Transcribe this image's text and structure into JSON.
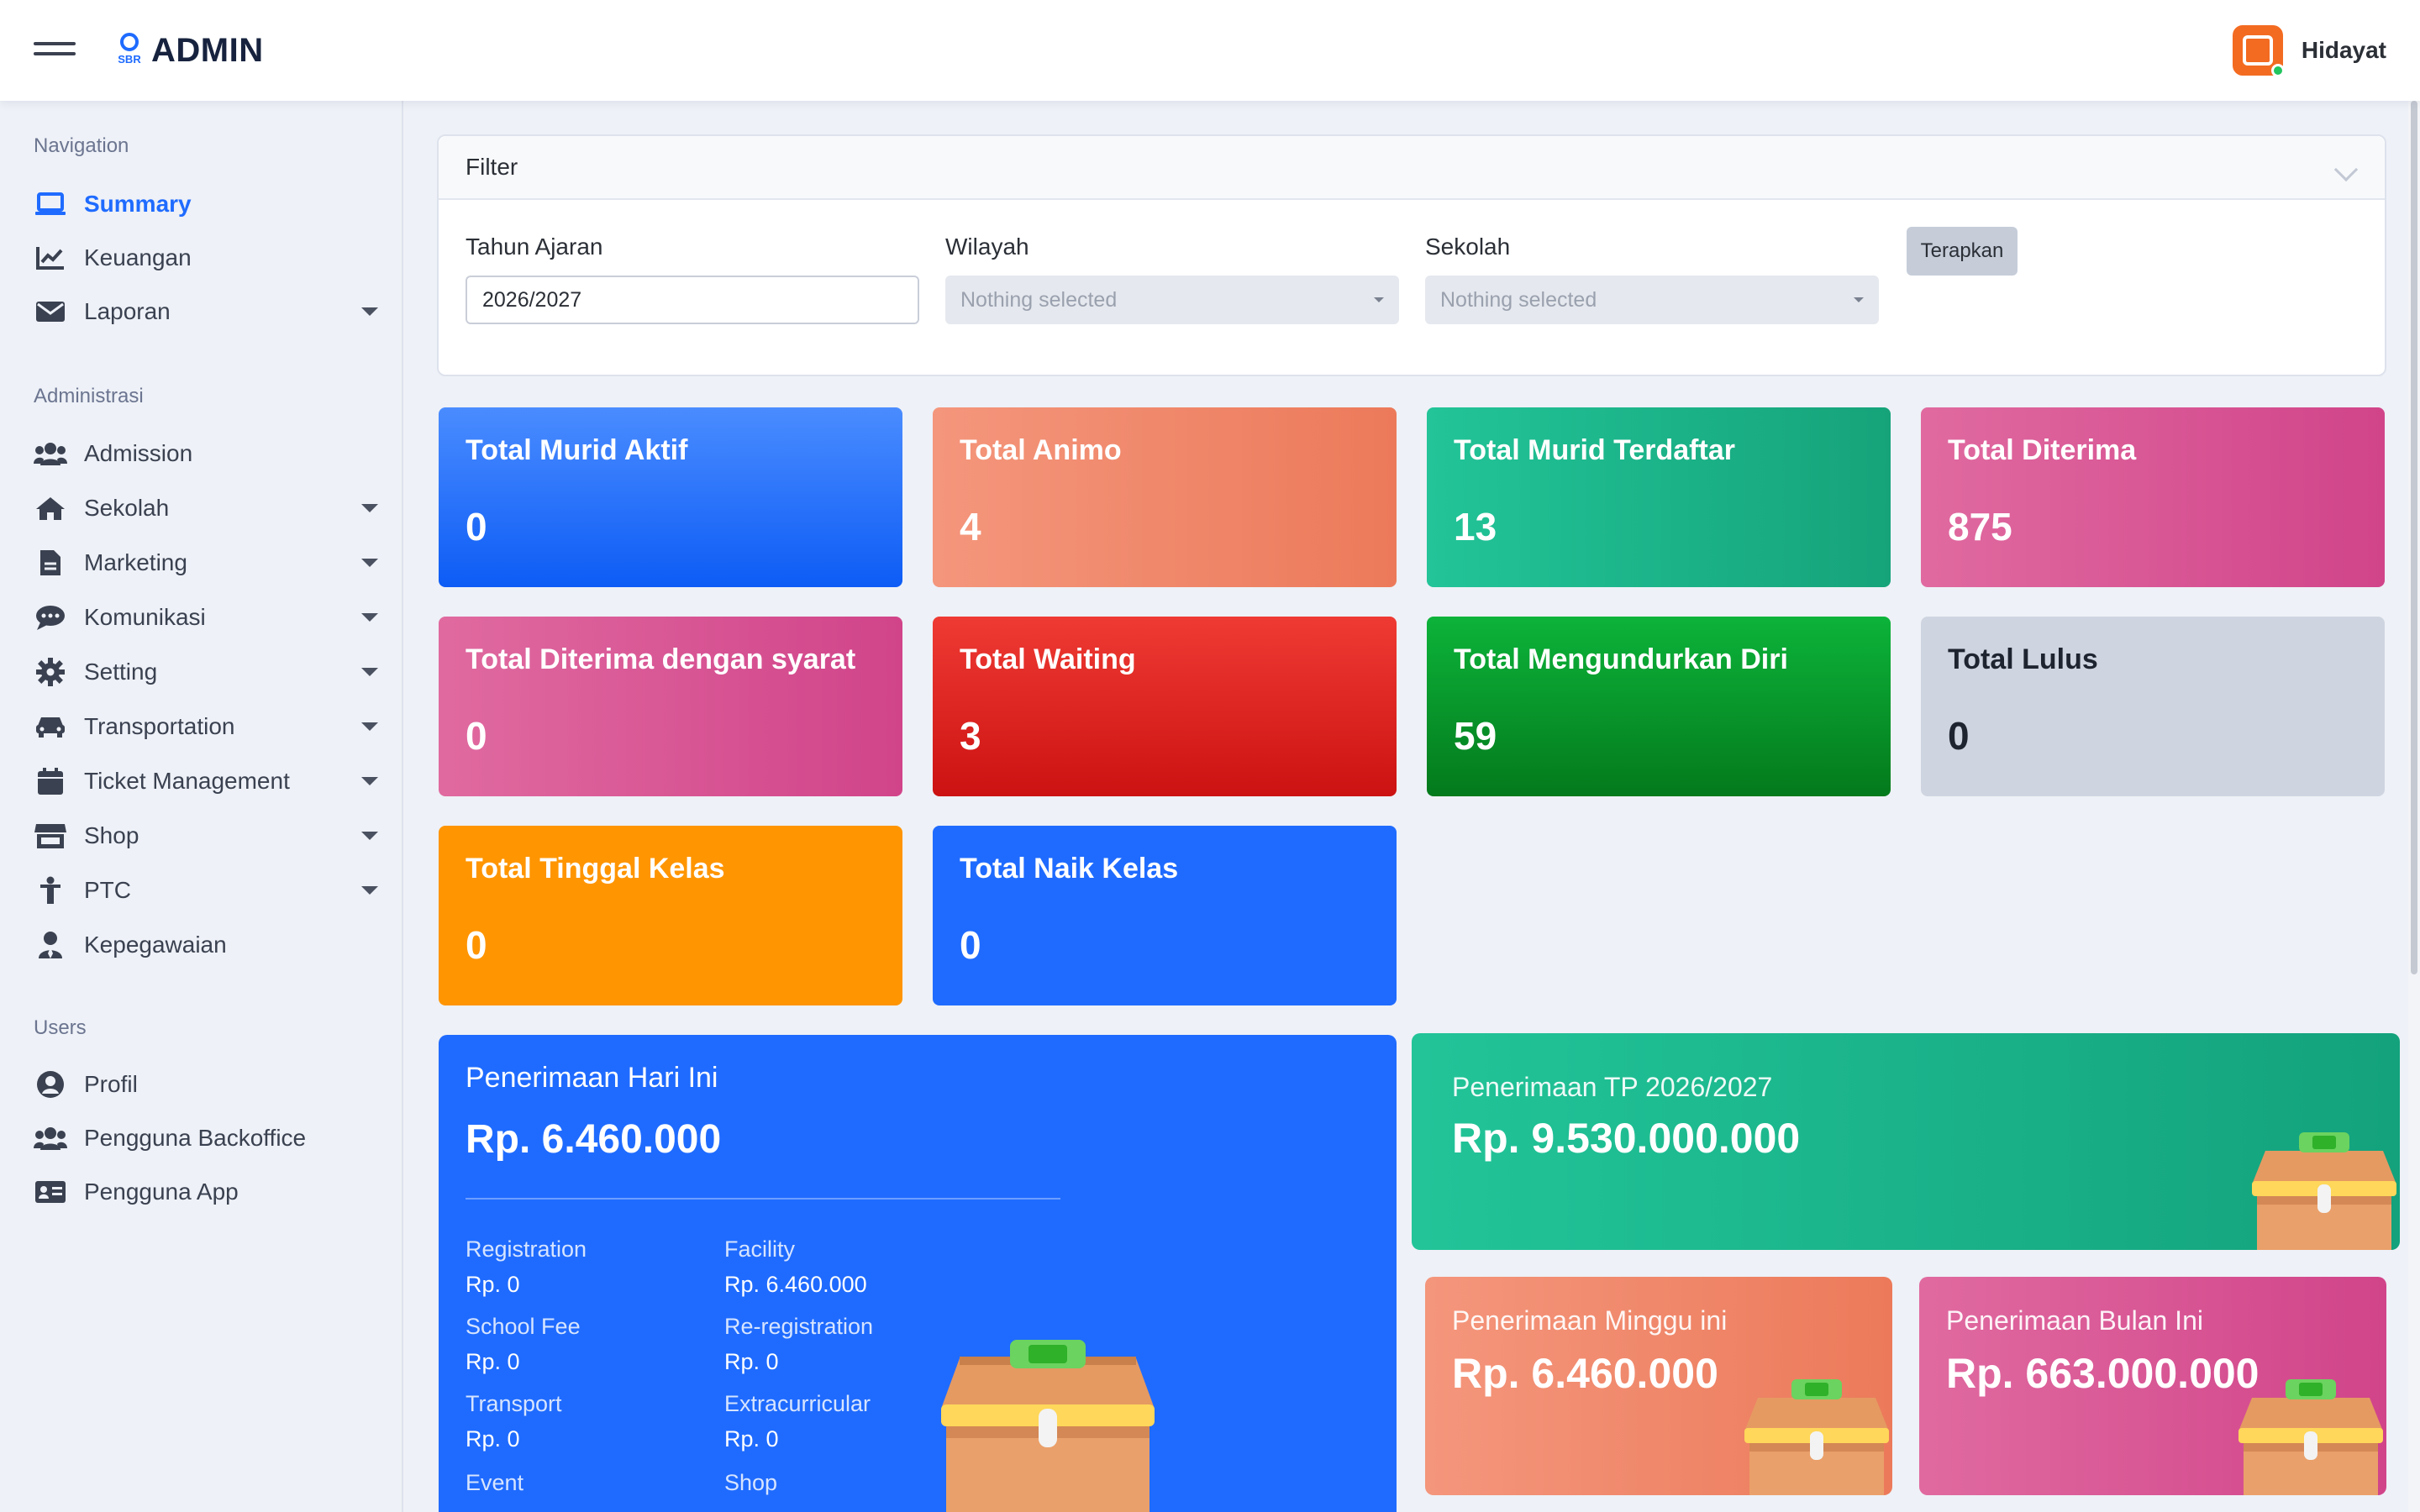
{
  "app": {
    "logo_small": "SBR",
    "title": "ADMIN"
  },
  "user": {
    "name": "Hidayat"
  },
  "sidebar": {
    "sections": {
      "navigation": "Navigation",
      "administrasi": "Administrasi",
      "users": "Users"
    },
    "items": [
      {
        "label": "Summary",
        "icon": "laptop-icon",
        "active": true,
        "has_submenu": false
      },
      {
        "label": "Keuangan",
        "icon": "chart-line-icon",
        "has_submenu": false
      },
      {
        "label": "Laporan",
        "icon": "envelope-icon",
        "has_submenu": true
      },
      {
        "label": "Admission",
        "icon": "users-icon",
        "has_submenu": false
      },
      {
        "label": "Sekolah",
        "icon": "home-icon",
        "has_submenu": true
      },
      {
        "label": "Marketing",
        "icon": "file-icon",
        "has_submenu": true
      },
      {
        "label": "Komunikasi",
        "icon": "chat-icon",
        "has_submenu": true
      },
      {
        "label": "Setting",
        "icon": "gear-icon",
        "has_submenu": true
      },
      {
        "label": "Transportation",
        "icon": "car-icon",
        "has_submenu": true
      },
      {
        "label": "Ticket Management",
        "icon": "calendar-icon",
        "has_submenu": true
      },
      {
        "label": "Shop",
        "icon": "store-icon",
        "has_submenu": true
      },
      {
        "label": "PTC",
        "icon": "person-icon",
        "has_submenu": true
      },
      {
        "label": "Kepegawaian",
        "icon": "employee-icon",
        "has_submenu": false
      },
      {
        "label": "Profil",
        "icon": "user-circle-icon",
        "has_submenu": false
      },
      {
        "label": "Pengguna Backoffice",
        "icon": "users-icon",
        "has_submenu": false
      },
      {
        "label": "Pengguna App",
        "icon": "id-card-icon",
        "has_submenu": false
      }
    ]
  },
  "filter": {
    "header": "Filter",
    "tahun_label": "Tahun Ajaran",
    "tahun_value": "2026/2027",
    "wilayah_label": "Wilayah",
    "wilayah_value": "Nothing selected",
    "sekolah_label": "Sekolah",
    "sekolah_value": "Nothing selected",
    "apply_label": "Terapkan"
  },
  "stats": [
    {
      "title": "Total Murid Aktif",
      "value": "0",
      "color": "#1f6bff"
    },
    {
      "title": "Total Animo",
      "value": "4",
      "color": "#f08a70"
    },
    {
      "title": "Total Murid Terdaftar",
      "value": "13",
      "color": "#1fb98a"
    },
    {
      "title": "Total Diterima",
      "value": "875",
      "color": "#d9568f"
    },
    {
      "title": "Total Diterima dengan syarat",
      "value": "0",
      "color": "#d9568f"
    },
    {
      "title": "Total Waiting",
      "value": "3",
      "color": "#e02222"
    },
    {
      "title": "Total Mengundurkan Diri",
      "value": "59",
      "color": "#0a9a2c"
    },
    {
      "title": "Total Lulus",
      "value": "0",
      "color": "#cfd5e0"
    },
    {
      "title": "Total Tinggal Kelas",
      "value": "0",
      "color": "#ff9500"
    },
    {
      "title": "Total Naik Kelas",
      "value": "0",
      "color": "#1f6bff"
    }
  ],
  "penerimaan_hari_ini": {
    "title": "Penerimaan Hari Ini",
    "value": "Rp. 6.460.000",
    "breakdown": [
      {
        "label": "Registration",
        "value": "Rp. 0"
      },
      {
        "label": "Facility",
        "value": "Rp. 6.460.000"
      },
      {
        "label": "School Fee",
        "value": "Rp. 0"
      },
      {
        "label": "Re-registration",
        "value": "Rp. 0"
      },
      {
        "label": "Transport",
        "value": "Rp. 0"
      },
      {
        "label": "Extracurricular",
        "value": "Rp. 0"
      },
      {
        "label": "Event",
        "value": ""
      },
      {
        "label": "Shop",
        "value": ""
      }
    ]
  },
  "penerimaan_tp": {
    "title": "Penerimaan TP 2026/2027",
    "value": "Rp. 9.530.000.000"
  },
  "penerimaan_minggu": {
    "title": "Penerimaan Minggu ini",
    "value": "Rp. 6.460.000"
  },
  "penerimaan_bulan": {
    "title": "Penerimaan Bulan Ini",
    "value": "Rp. 663.000.000"
  }
}
